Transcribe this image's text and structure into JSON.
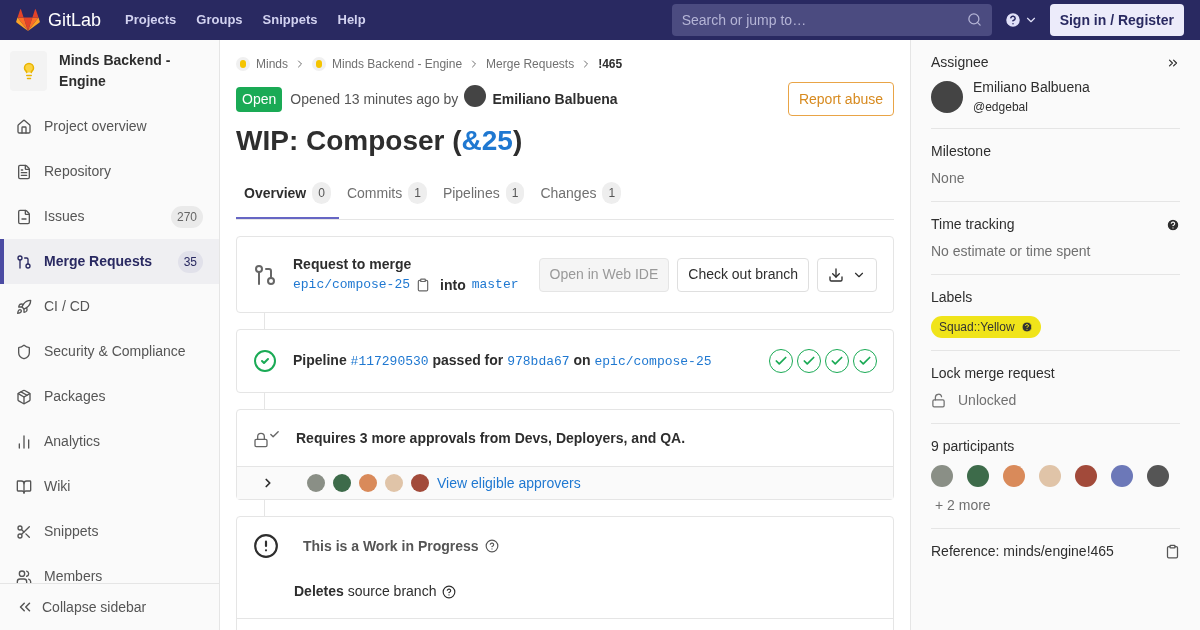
{
  "navbar": {
    "logo_text": "GitLab",
    "links": [
      "Projects",
      "Groups",
      "Snippets",
      "Help"
    ],
    "search": {
      "placeholder": "Search or jump to…"
    },
    "sign_in": "Sign in / Register"
  },
  "sidebar": {
    "project_name": "Minds Backend - Engine",
    "items": [
      {
        "label": "Project overview",
        "selected": false
      },
      {
        "label": "Repository",
        "selected": false
      },
      {
        "label": "Issues",
        "count": "270",
        "selected": false
      },
      {
        "label": "Merge Requests",
        "count": "35",
        "selected": true
      },
      {
        "label": "CI / CD",
        "selected": false
      },
      {
        "label": "Security & Compliance",
        "selected": false
      },
      {
        "label": "Packages",
        "selected": false
      },
      {
        "label": "Analytics",
        "selected": false
      },
      {
        "label": "Wiki",
        "selected": false
      },
      {
        "label": "Snippets",
        "selected": false
      },
      {
        "label": "Members",
        "selected": false
      }
    ],
    "collapse": "Collapse sidebar"
  },
  "breadcrumbs": [
    {
      "label": "Minds",
      "kind": "project"
    },
    {
      "label": "Minds Backend - Engine",
      "kind": "project"
    },
    {
      "label": "Merge Requests",
      "kind": "page"
    },
    {
      "label": "!465",
      "kind": "current"
    }
  ],
  "header": {
    "status": "Open",
    "opened": "Opened 13 minutes ago by",
    "author": "Emiliano Balbuena",
    "report": "Report abuse"
  },
  "title": {
    "text": "WIP: Composer (",
    "link": "&25",
    "end": ")"
  },
  "tabs": [
    {
      "label": "Overview",
      "count": "0",
      "selected": true
    },
    {
      "label": "Commits",
      "count": "1",
      "selected": false
    },
    {
      "label": "Pipelines",
      "count": "1",
      "selected": false
    },
    {
      "label": "Changes",
      "count": "1",
      "selected": false
    }
  ],
  "merge_widget": {
    "heading": "Request to merge",
    "source": "epic/compose-25",
    "into": "into",
    "target": "master",
    "web_ide": {
      "label": "Open in Web IDE",
      "disabled": true
    },
    "checkout": "Check out branch"
  },
  "pipeline": {
    "label": "Pipeline",
    "id": "#117290530",
    "passed_for": "passed for",
    "commit": "978bda67",
    "on": "on",
    "branch": "epic/compose-25",
    "stages": [
      {
        "passed": true
      },
      {
        "passed": true
      },
      {
        "passed": true
      },
      {
        "passed": true
      }
    ]
  },
  "approvals": {
    "text": "Requires 3 more approvals from Devs, Deployers, and QA.",
    "link": "View eligible approvers",
    "expanded": false
  },
  "wip": {
    "text": "This is a Work in Progress",
    "deletes": "**Deletes** source branch"
  },
  "right_sidebar": {
    "sections": [
      {
        "kind": "assignee",
        "title": "Assignee",
        "name": "Emiliano Balbuena",
        "handle": "@edgebal"
      },
      {
        "kind": "value",
        "title": "Milestone",
        "value": "None"
      },
      {
        "kind": "help",
        "title": "Time tracking",
        "value": "No estimate or time spent"
      },
      {
        "kind": "labels",
        "title": "Labels",
        "labels": [
          {
            "text": "Squad::Yellow",
            "color": "#f0e41a"
          }
        ]
      },
      {
        "kind": "lock",
        "title": "Lock merge request",
        "value": "Unlocked"
      },
      {
        "kind": "participants",
        "title": "9 participants",
        "more": "+ 2 more"
      },
      {
        "kind": "reference",
        "title": "Reference: minds/engine!465"
      }
    ]
  }
}
